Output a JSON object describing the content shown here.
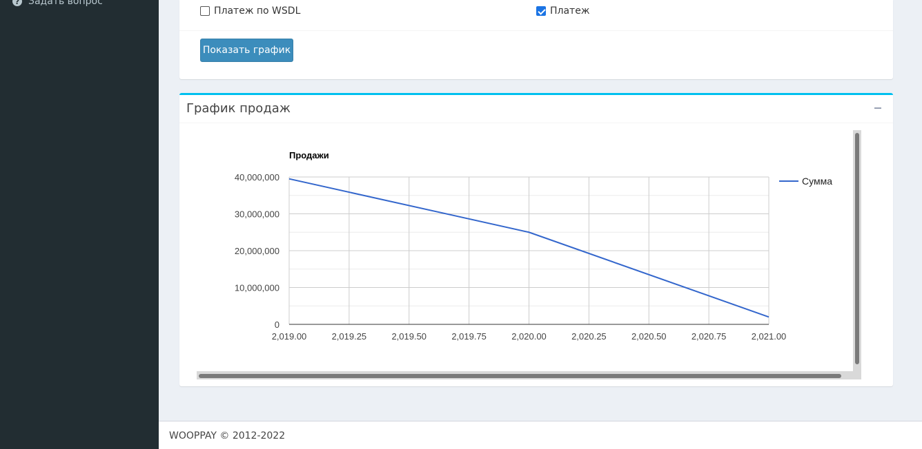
{
  "sidebar": {
    "items": [
      {
        "label": "Задать вопрос",
        "icon": "question-circle-icon"
      }
    ]
  },
  "filters": {
    "wsdl_payment": {
      "label": "Платеж по WSDL",
      "checked": false
    },
    "payment": {
      "label": "Платеж",
      "checked": true
    },
    "show_chart_label": "Показать график"
  },
  "chart_box": {
    "title": "График продаж",
    "collapse_icon": "minus-icon"
  },
  "chart_data": {
    "type": "line",
    "title": "Продажи",
    "xlabel": "",
    "ylabel": "",
    "x_ticks": [
      "2,019.00",
      "2,019.25",
      "2,019.50",
      "2,019.75",
      "2,020.00",
      "2,020.25",
      "2,020.50",
      "2,020.75",
      "2,021.00"
    ],
    "y_ticks": [
      "0",
      "10,000,000",
      "20,000,000",
      "30,000,000",
      "40,000,000"
    ],
    "xlim": [
      2019,
      2021
    ],
    "ylim": [
      0,
      40000000
    ],
    "series": [
      {
        "name": "Сумма",
        "color": "#3366cc",
        "x": [
          2019,
          2020,
          2021
        ],
        "y": [
          39500000,
          25000000,
          2000000
        ]
      }
    ],
    "legend_position": "right",
    "grid": true
  },
  "footer": {
    "text": "WOOPPAY © 2012-2022"
  }
}
